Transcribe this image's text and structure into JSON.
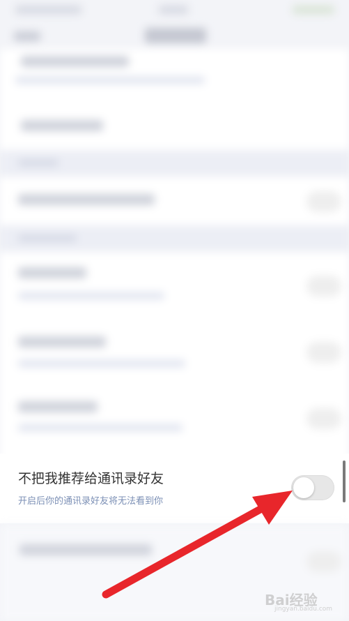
{
  "privacy_item": {
    "title": "不把我推荐给通讯录好友",
    "subtitle": "开启后你的通讯录好友将无法看到你",
    "toggle_on": false
  },
  "watermark": {
    "text": "Bai经验",
    "sub": "jingyan.baidu.com"
  },
  "colors": {
    "arrow": "#e8262b",
    "subtitle": "#7b8fb5"
  }
}
